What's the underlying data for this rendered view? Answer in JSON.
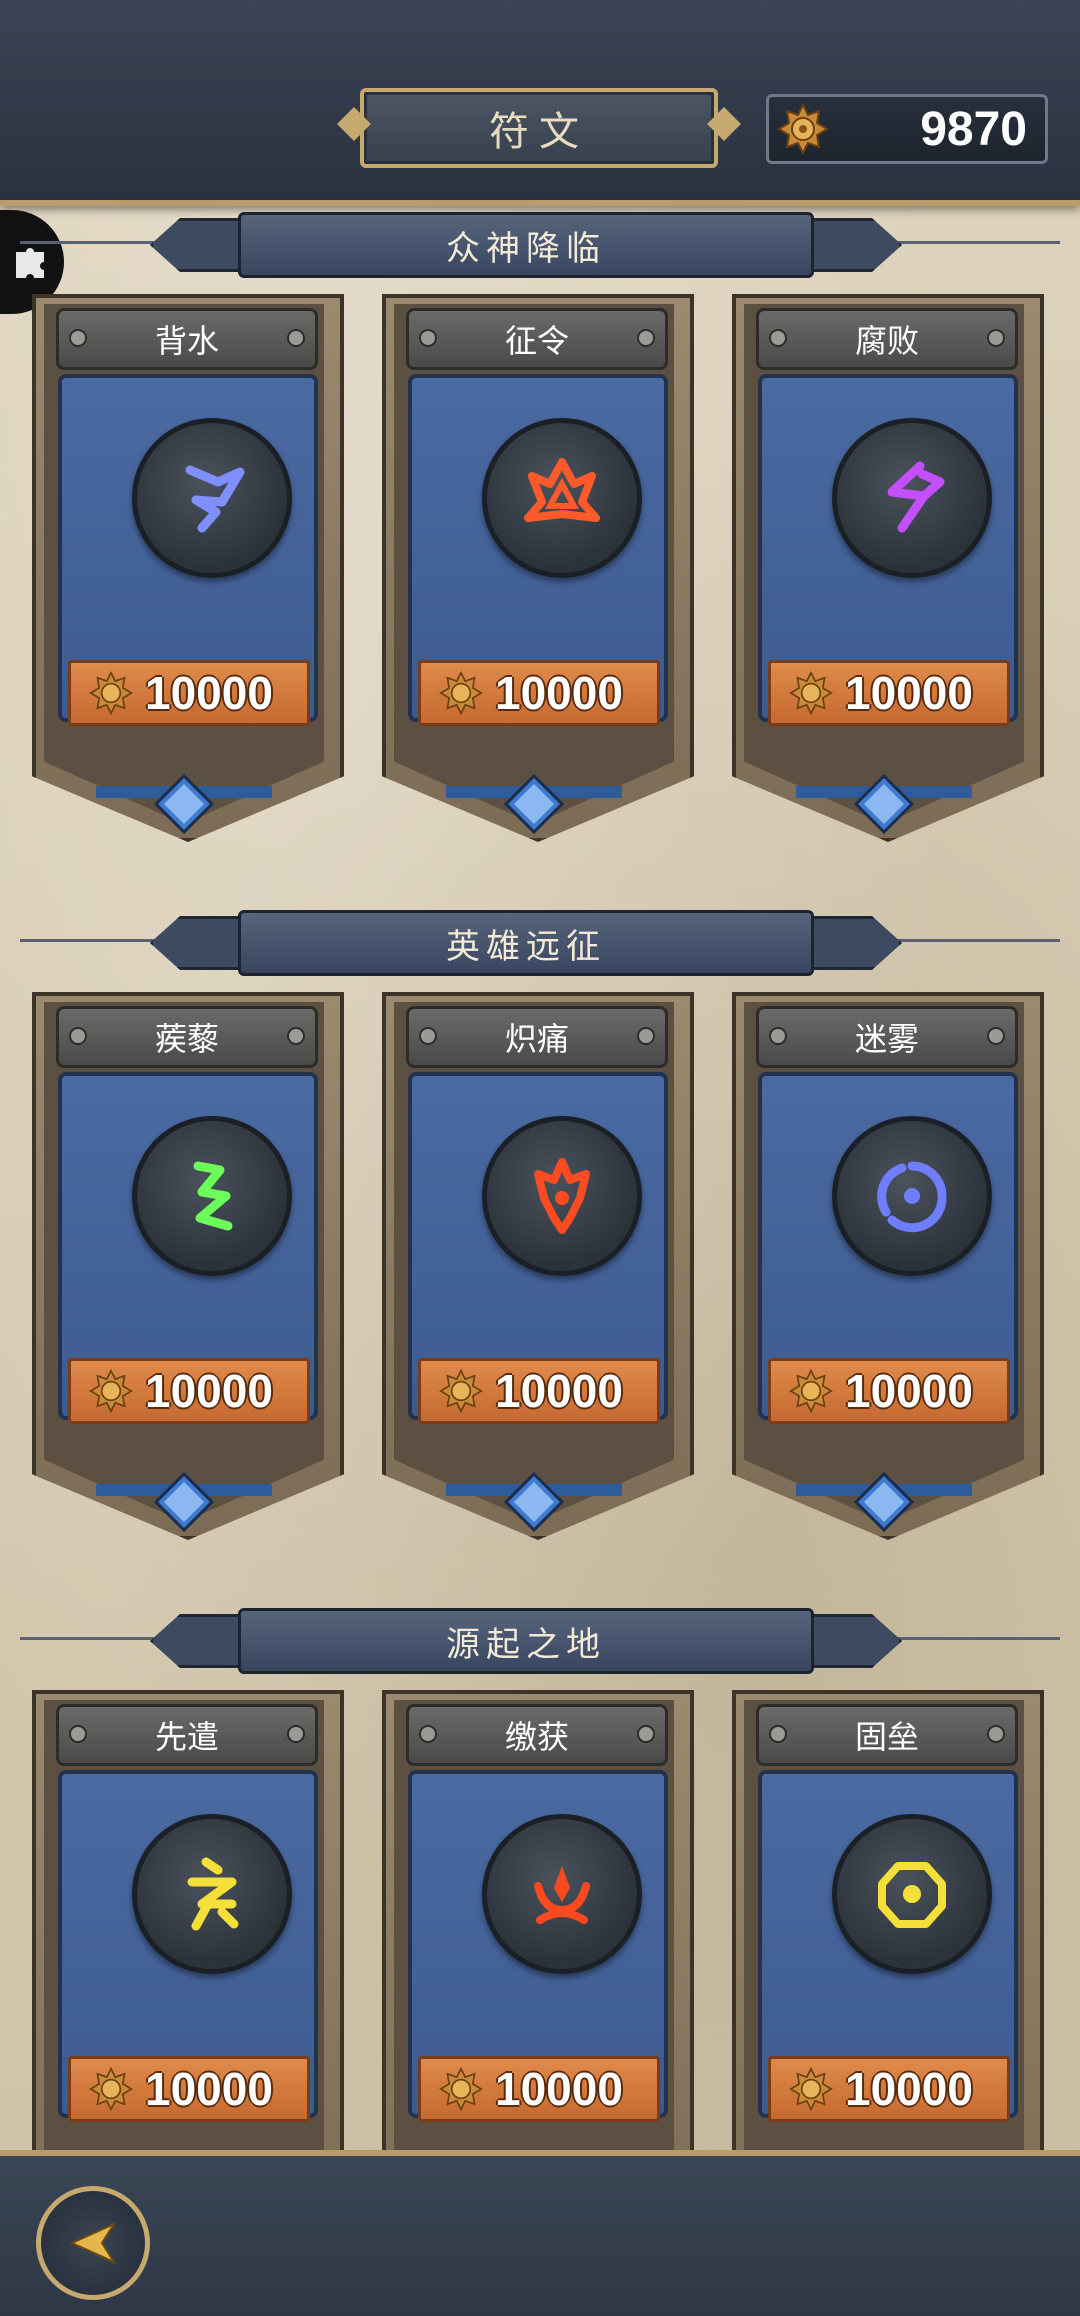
{
  "header": {
    "title": "符文",
    "currency": {
      "icon": "medallion-icon",
      "value": "9870"
    }
  },
  "side_tab": {
    "icon": "puzzle-icon"
  },
  "sections": [
    {
      "title": "众神降临",
      "runes": [
        {
          "name": "背水",
          "price": "10000",
          "glyph_color": "#7f8fff",
          "icon": "rune-glyph-blue-icon"
        },
        {
          "name": "征令",
          "price": "10000",
          "glyph_color": "#ff5a2a",
          "icon": "rune-glyph-red-icon"
        },
        {
          "name": "腐败",
          "price": "10000",
          "glyph_color": "#c44fff",
          "icon": "rune-glyph-purple-icon"
        }
      ]
    },
    {
      "title": "英雄远征",
      "runes": [
        {
          "name": "蒺藜",
          "price": "10000",
          "glyph_color": "#6cff5a",
          "icon": "rune-glyph-green-icon"
        },
        {
          "name": "炽痛",
          "price": "10000",
          "glyph_color": "#ff4a22",
          "icon": "rune-glyph-red-icon"
        },
        {
          "name": "迷雾",
          "price": "10000",
          "glyph_color": "#6f7dff",
          "icon": "rune-glyph-blue-icon"
        }
      ]
    },
    {
      "title": "源起之地",
      "runes": [
        {
          "name": "先遣",
          "price": "10000",
          "glyph_color": "#f5e03a",
          "icon": "rune-glyph-yellow-icon"
        },
        {
          "name": "缴获",
          "price": "10000",
          "glyph_color": "#ff4a1f",
          "icon": "rune-glyph-red-icon"
        },
        {
          "name": "固垒",
          "price": "10000",
          "glyph_color": "#f5e03a",
          "icon": "rune-glyph-yellow-icon"
        }
      ]
    }
  ],
  "footer": {
    "back_icon": "back-arrow-icon"
  },
  "colors": {
    "header_bg": "#2e3746",
    "gold_trim": "#c6a96f",
    "panel_blue": "#4a6aa2",
    "price_orange": "#d5773b"
  }
}
